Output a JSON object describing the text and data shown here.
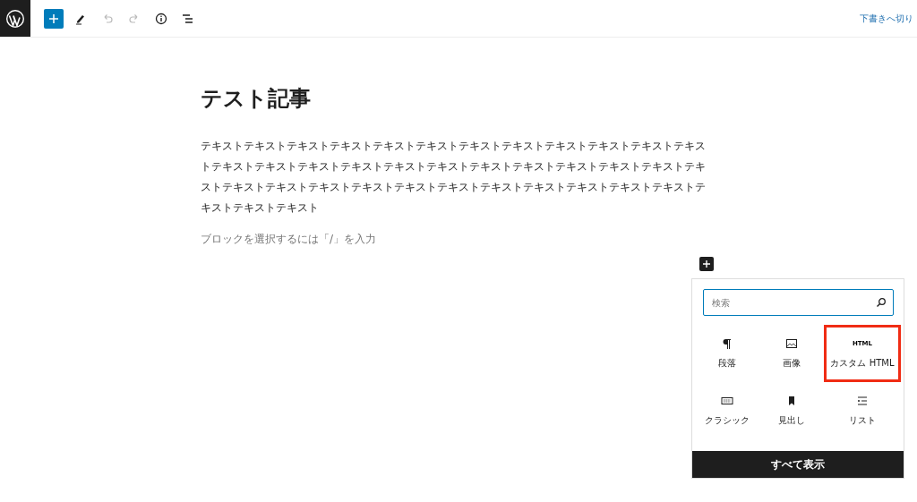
{
  "toolbar": {
    "draft_link": "下書きへ切り"
  },
  "post": {
    "title": "テスト記事",
    "paragraph": "テキストテキストテキストテキストテキストテキストテキストテキストテキストテキストテキストテキストテキストテキストテキストテキストテキストテキストテキストテキストテキストテキストテキストテキストテキストテキストテキストテキストテキストテキストテキストテキストテキストテキストテキストテキストテキストテキスト",
    "placeholder": "ブロックを選択するには「/」を入力"
  },
  "inserter": {
    "search": {
      "placeholder": "検索"
    },
    "blocks": [
      {
        "kind": "paragraph",
        "label": "段落",
        "highlighted": false
      },
      {
        "kind": "image",
        "label": "画像",
        "highlighted": false
      },
      {
        "kind": "html",
        "label": "カスタム HTML",
        "icon_text": "HTML",
        "highlighted": true
      },
      {
        "kind": "classic",
        "label": "クラシック",
        "highlighted": false
      },
      {
        "kind": "heading",
        "label": "見出し",
        "highlighted": false
      },
      {
        "kind": "list",
        "label": "リスト",
        "highlighted": false
      }
    ],
    "show_all": "すべて表示"
  }
}
